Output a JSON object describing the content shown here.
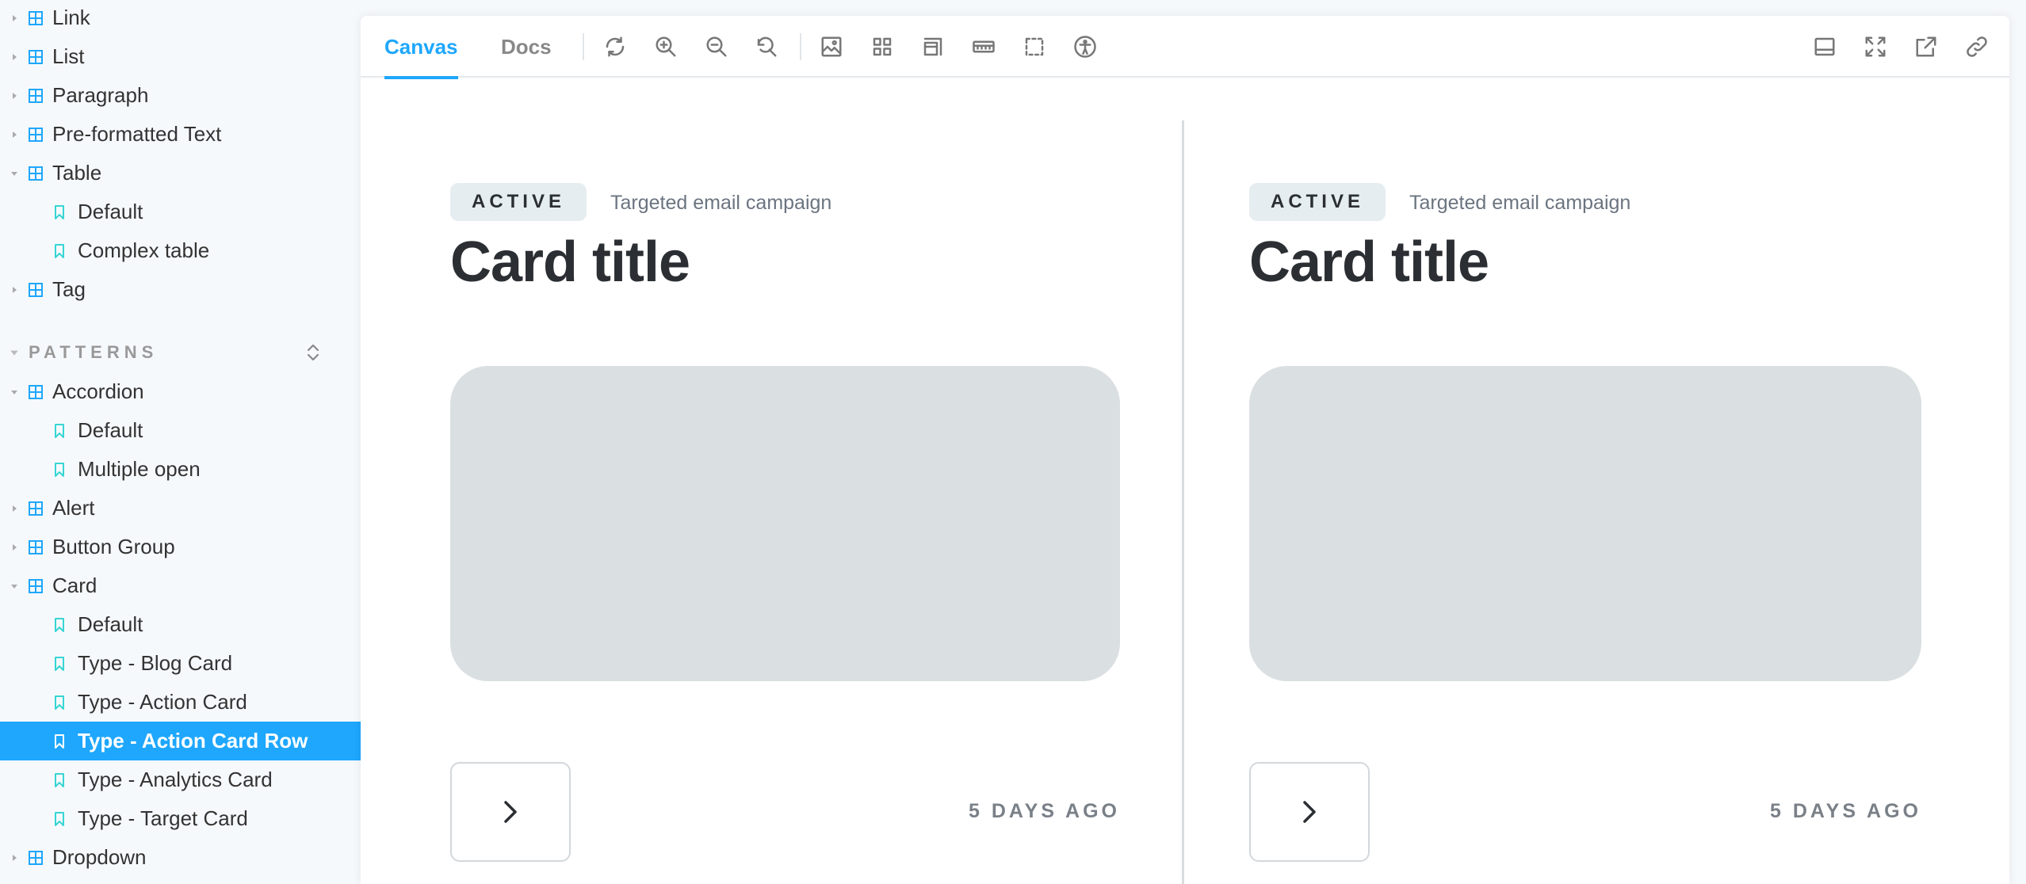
{
  "sidebar": {
    "components_tail": [
      {
        "label": "Link",
        "expanded": false
      },
      {
        "label": "List",
        "expanded": false
      },
      {
        "label": "Paragraph",
        "expanded": false
      },
      {
        "label": "Pre-formatted Text",
        "expanded": false
      },
      {
        "label": "Table",
        "expanded": true,
        "stories": [
          "Default",
          "Complex table"
        ]
      },
      {
        "label": "Tag",
        "expanded": false
      }
    ],
    "patterns_title": "PATTERNS",
    "patterns": [
      {
        "label": "Accordion",
        "expanded": true,
        "stories": [
          "Default",
          "Multiple open"
        ]
      },
      {
        "label": "Alert",
        "expanded": false
      },
      {
        "label": "Button Group",
        "expanded": false
      },
      {
        "label": "Card",
        "expanded": true,
        "stories": [
          "Default",
          "Type - Blog Card",
          "Type - Action Card",
          "Type - Action Card Row",
          "Type - Analytics Card",
          "Type - Target Card"
        ]
      },
      {
        "label": "Dropdown",
        "expanded": false
      }
    ],
    "selected_story": "Type - Action Card Row"
  },
  "toolbar": {
    "tabs": [
      {
        "label": "Canvas",
        "active": true
      },
      {
        "label": "Docs",
        "active": false
      }
    ],
    "tools": [
      "reload-icon",
      "zoom-in-icon",
      "zoom-out-icon",
      "zoom-reset-icon",
      "background-icon",
      "grid-icon",
      "viewport-icon",
      "measure-icon",
      "outline-icon",
      "accessibility-icon"
    ],
    "right_tools": [
      "panel-icon",
      "fullscreen-icon",
      "open-new-tab-icon",
      "copy-link-icon"
    ]
  },
  "cards": [
    {
      "badge": "ACTIVE",
      "subtitle": "Targeted email campaign",
      "title": "Card title",
      "timestamp": "5 DAYS AGO"
    },
    {
      "badge": "ACTIVE",
      "subtitle": "Targeted email campaign",
      "title": "Card title",
      "timestamp": "5 DAYS AGO"
    }
  ],
  "colors": {
    "accent": "#1ea7fd",
    "story_icon": "#37d5d3",
    "component_icon": "#1ea7fd",
    "placeholder": "#dadfe2",
    "badge_bg": "#e6edf1"
  }
}
